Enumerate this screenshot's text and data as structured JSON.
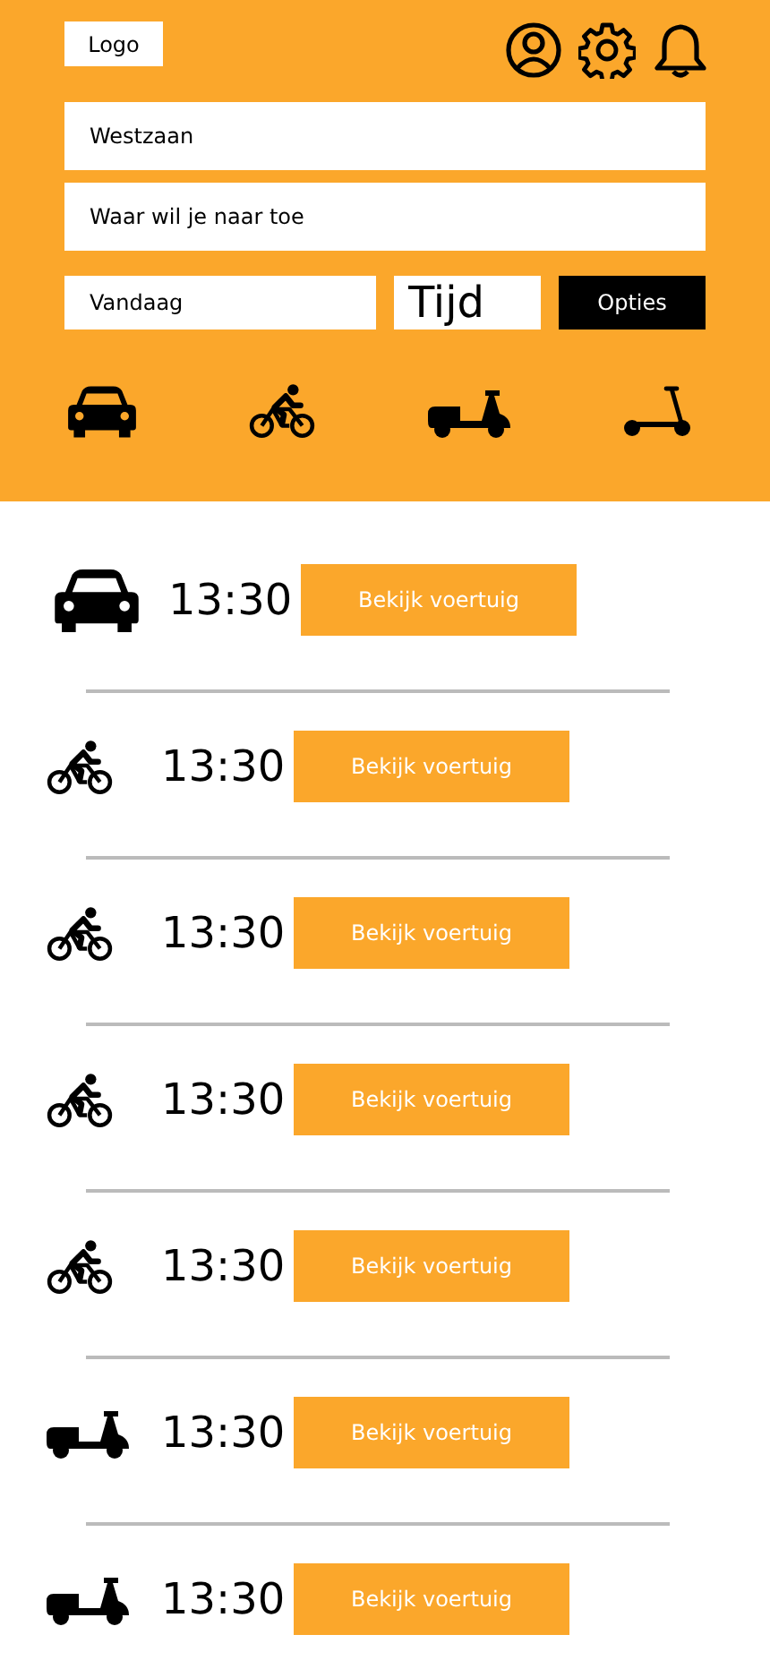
{
  "header": {
    "logo": "Logo"
  },
  "search": {
    "from": {
      "value": "Westzaan"
    },
    "to": {
      "placeholder": "Waar wil je naar toe"
    },
    "date": {
      "value": "Vandaag"
    },
    "time": {
      "placeholder": "Tijd"
    },
    "options_button": "Opties"
  },
  "modes": [
    {
      "kind": "car"
    },
    {
      "kind": "bike"
    },
    {
      "kind": "scooter"
    },
    {
      "kind": "kickscooter"
    }
  ],
  "results": [
    {
      "kind": "car",
      "time": "13:30",
      "button": "Bekijk voertuig"
    },
    {
      "kind": "bike",
      "time": "13:30",
      "button": "Bekijk voertuig"
    },
    {
      "kind": "bike",
      "time": "13:30",
      "button": "Bekijk voertuig"
    },
    {
      "kind": "bike",
      "time": "13:30",
      "button": "Bekijk voertuig"
    },
    {
      "kind": "bike",
      "time": "13:30",
      "button": "Bekijk voertuig"
    },
    {
      "kind": "scooter",
      "time": "13:30",
      "button": "Bekijk voertuig"
    },
    {
      "kind": "scooter",
      "time": "13:30",
      "button": "Bekijk voertuig"
    }
  ]
}
